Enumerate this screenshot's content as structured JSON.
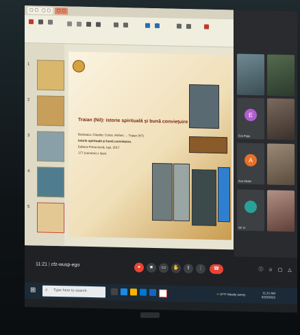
{
  "slide": {
    "title": "Traian (Nil): istorie spirituală și bună conviețuire",
    "lines": [
      "Bostoaca, Claudiu; Cotos, Adrian; ... Traian (N7)",
      "Istorie spirituală și bună conviețuire.",
      "Editura Presa bună, Iași, 2017",
      "177 (numere) x ilustr."
    ]
  },
  "thumbs": [
    "1",
    "2",
    "3",
    "4",
    "5",
    "6"
  ],
  "participants": [
    {
      "name": "Eva Pagu",
      "initial": "E",
      "color": "#b15dd0"
    },
    {
      "name": "Ana Madoi",
      "initial": "A",
      "color": "#e8702a"
    },
    {
      "name": "Ioli 11",
      "initial": "",
      "color": "#2aa198"
    }
  ],
  "meeting": {
    "time": "11:21",
    "code": "cfz-wusp-ego"
  },
  "taskbar": {
    "search_placeholder": "Type here to search",
    "weather": "57°F Mostly sunny",
    "time": "11:21 AM",
    "date": "6/29/2022"
  }
}
